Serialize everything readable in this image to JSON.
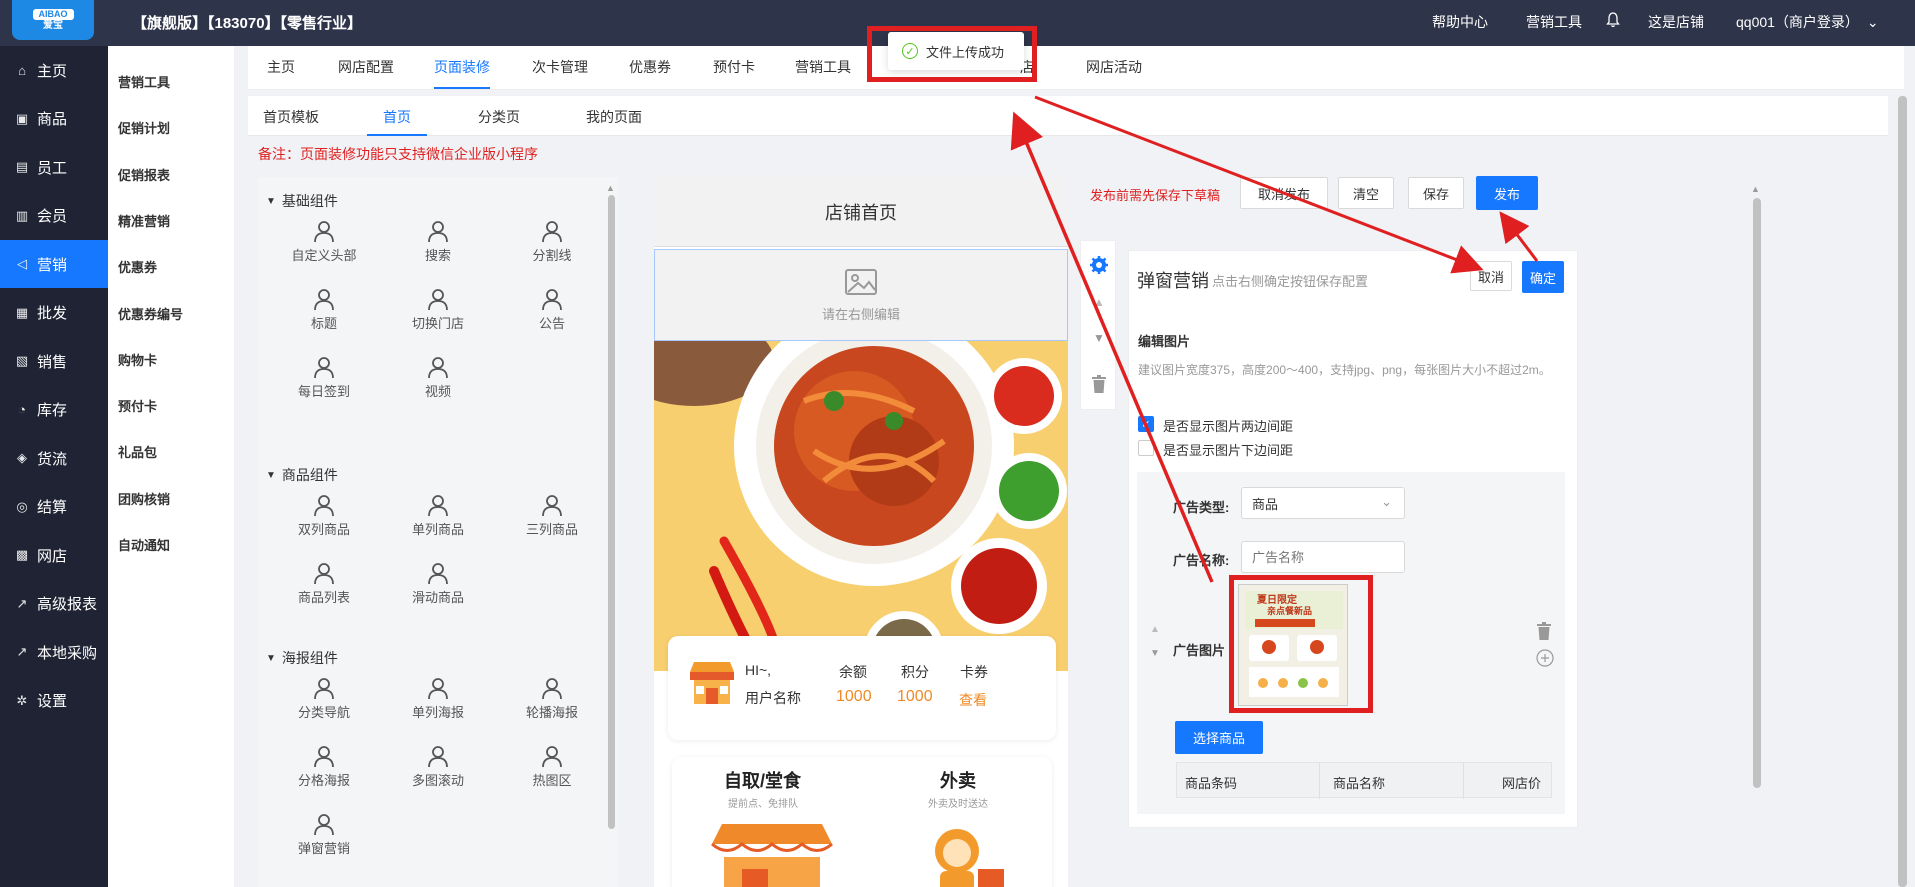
{
  "header": {
    "logo_text": "AIBAO",
    "logo_sub": "爱宝",
    "title": "【旗舰版】【183070】【零售行业】",
    "nav": [
      "帮助中心",
      "营销工具",
      "这是店铺",
      "qq001（商户登录）"
    ]
  },
  "sidebar": {
    "items": [
      {
        "label": "主页",
        "icon": "home-icon"
      },
      {
        "label": "商品",
        "icon": "box-icon"
      },
      {
        "label": "员工",
        "icon": "staff-icon"
      },
      {
        "label": "会员",
        "icon": "member-icon"
      },
      {
        "label": "营销",
        "icon": "megaphone-icon"
      },
      {
        "label": "批发",
        "icon": "wholesale-icon"
      },
      {
        "label": "销售",
        "icon": "chart-icon"
      },
      {
        "label": "库存",
        "icon": "stock-icon"
      },
      {
        "label": "货流",
        "icon": "flow-icon"
      },
      {
        "label": "结算",
        "icon": "settle-icon"
      },
      {
        "label": "网店",
        "icon": "shop-icon"
      },
      {
        "label": "高级报表",
        "icon": "report-icon"
      },
      {
        "label": "本地采购",
        "icon": "purchase-icon"
      },
      {
        "label": "设置",
        "icon": "gear-icon"
      }
    ],
    "active": "营销"
  },
  "submenu": {
    "items": [
      "营销工具",
      "促销计划",
      "促销报表",
      "精准营销",
      "优惠券",
      "优惠券编号",
      "购物卡",
      "预付卡",
      "礼品包",
      "团购核销",
      "自动通知"
    ]
  },
  "tabs": {
    "items": [
      "主页",
      "网店配置",
      "页面装修",
      "次卡管理",
      "优惠券",
      "预付卡",
      "营销工具",
      "店",
      "网店活动"
    ],
    "active": "页面装修"
  },
  "subtabs": {
    "items": [
      "首页模板",
      "首页",
      "分类页",
      "我的页面"
    ],
    "active": "首页"
  },
  "notice": "备注：页面装修功能只支持微信企业版小程序",
  "toast": {
    "text": "文件上传成功"
  },
  "components": {
    "groups": [
      {
        "title": "基础组件",
        "items": [
          "自定义头部",
          "搜索",
          "分割线",
          "标题",
          "切换门店",
          "公告",
          "每日签到",
          "视频"
        ]
      },
      {
        "title": "商品组件",
        "items": [
          "双列商品",
          "单列商品",
          "三列商品",
          "商品列表",
          "滑动商品"
        ]
      },
      {
        "title": "海报组件",
        "items": [
          "分类导航",
          "单列海报",
          "轮播海报",
          "分格海报",
          "多图滚动",
          "热图区",
          "弹窗营销"
        ]
      }
    ]
  },
  "preview": {
    "header": "店铺首页",
    "image_placeholder": "请在右侧编辑",
    "member": {
      "greeting": "HI~,",
      "username": "用户名称",
      "cols": [
        {
          "label": "余额",
          "value": "1000"
        },
        {
          "label": "积分",
          "value": "1000"
        },
        {
          "label": "卡券",
          "value": "查看"
        }
      ]
    },
    "order": {
      "left_title": "自取/堂食",
      "left_sub": "提前点、免排队",
      "right_title": "外卖",
      "right_sub": "外卖及时送达"
    }
  },
  "editor": {
    "publish_hint": "发布前需先保存下草稿",
    "buttons": {
      "cancel_publish": "取消发布",
      "clear": "清空",
      "save": "保存",
      "publish": "发布"
    },
    "title": "弹窗营销",
    "subtitle": "点击右侧确定按钮保存配置",
    "cancel": "取消",
    "confirm": "确定",
    "section": "编辑图片",
    "desc": "建议图片宽度375，高度200～400，支持jpg、png，每张图片大小不超过2m。",
    "check1": {
      "label": "是否显示图片两边间距",
      "checked": true
    },
    "check2": {
      "label": "是否显示图片下边间距",
      "checked": false
    },
    "ad_type_label": "广告类型:",
    "ad_type_value": "商品",
    "ad_name_label": "广告名称:",
    "ad_name_placeholder": "广告名称",
    "ad_image_label": "广告图片",
    "thumb_title": "夏日限定",
    "thumb_sub": "亲点餐新品",
    "select_goods": "选择商品",
    "table_headers": [
      "商品条码",
      "商品名称",
      "网店价"
    ]
  },
  "colors": {
    "accent": "#1677ff",
    "sidebar_bg": "#1f2333",
    "topbar_bg": "#2e3449",
    "annotation_red": "#e02020",
    "price_orange": "#f08a24"
  }
}
